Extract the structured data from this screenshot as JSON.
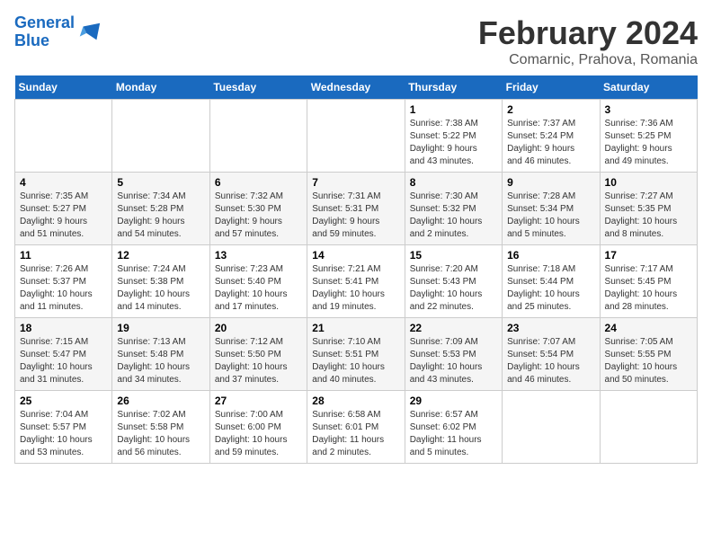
{
  "header": {
    "logo_line1": "General",
    "logo_line2": "Blue",
    "main_title": "February 2024",
    "sub_title": "Comarnic, Prahova, Romania"
  },
  "days_of_week": [
    "Sunday",
    "Monday",
    "Tuesday",
    "Wednesday",
    "Thursday",
    "Friday",
    "Saturday"
  ],
  "weeks": [
    [
      {
        "day": "",
        "info": ""
      },
      {
        "day": "",
        "info": ""
      },
      {
        "day": "",
        "info": ""
      },
      {
        "day": "",
        "info": ""
      },
      {
        "day": "1",
        "info": "Sunrise: 7:38 AM\nSunset: 5:22 PM\nDaylight: 9 hours\nand 43 minutes."
      },
      {
        "day": "2",
        "info": "Sunrise: 7:37 AM\nSunset: 5:24 PM\nDaylight: 9 hours\nand 46 minutes."
      },
      {
        "day": "3",
        "info": "Sunrise: 7:36 AM\nSunset: 5:25 PM\nDaylight: 9 hours\nand 49 minutes."
      }
    ],
    [
      {
        "day": "4",
        "info": "Sunrise: 7:35 AM\nSunset: 5:27 PM\nDaylight: 9 hours\nand 51 minutes."
      },
      {
        "day": "5",
        "info": "Sunrise: 7:34 AM\nSunset: 5:28 PM\nDaylight: 9 hours\nand 54 minutes."
      },
      {
        "day": "6",
        "info": "Sunrise: 7:32 AM\nSunset: 5:30 PM\nDaylight: 9 hours\nand 57 minutes."
      },
      {
        "day": "7",
        "info": "Sunrise: 7:31 AM\nSunset: 5:31 PM\nDaylight: 9 hours\nand 59 minutes."
      },
      {
        "day": "8",
        "info": "Sunrise: 7:30 AM\nSunset: 5:32 PM\nDaylight: 10 hours\nand 2 minutes."
      },
      {
        "day": "9",
        "info": "Sunrise: 7:28 AM\nSunset: 5:34 PM\nDaylight: 10 hours\nand 5 minutes."
      },
      {
        "day": "10",
        "info": "Sunrise: 7:27 AM\nSunset: 5:35 PM\nDaylight: 10 hours\nand 8 minutes."
      }
    ],
    [
      {
        "day": "11",
        "info": "Sunrise: 7:26 AM\nSunset: 5:37 PM\nDaylight: 10 hours\nand 11 minutes."
      },
      {
        "day": "12",
        "info": "Sunrise: 7:24 AM\nSunset: 5:38 PM\nDaylight: 10 hours\nand 14 minutes."
      },
      {
        "day": "13",
        "info": "Sunrise: 7:23 AM\nSunset: 5:40 PM\nDaylight: 10 hours\nand 17 minutes."
      },
      {
        "day": "14",
        "info": "Sunrise: 7:21 AM\nSunset: 5:41 PM\nDaylight: 10 hours\nand 19 minutes."
      },
      {
        "day": "15",
        "info": "Sunrise: 7:20 AM\nSunset: 5:43 PM\nDaylight: 10 hours\nand 22 minutes."
      },
      {
        "day": "16",
        "info": "Sunrise: 7:18 AM\nSunset: 5:44 PM\nDaylight: 10 hours\nand 25 minutes."
      },
      {
        "day": "17",
        "info": "Sunrise: 7:17 AM\nSunset: 5:45 PM\nDaylight: 10 hours\nand 28 minutes."
      }
    ],
    [
      {
        "day": "18",
        "info": "Sunrise: 7:15 AM\nSunset: 5:47 PM\nDaylight: 10 hours\nand 31 minutes."
      },
      {
        "day": "19",
        "info": "Sunrise: 7:13 AM\nSunset: 5:48 PM\nDaylight: 10 hours\nand 34 minutes."
      },
      {
        "day": "20",
        "info": "Sunrise: 7:12 AM\nSunset: 5:50 PM\nDaylight: 10 hours\nand 37 minutes."
      },
      {
        "day": "21",
        "info": "Sunrise: 7:10 AM\nSunset: 5:51 PM\nDaylight: 10 hours\nand 40 minutes."
      },
      {
        "day": "22",
        "info": "Sunrise: 7:09 AM\nSunset: 5:53 PM\nDaylight: 10 hours\nand 43 minutes."
      },
      {
        "day": "23",
        "info": "Sunrise: 7:07 AM\nSunset: 5:54 PM\nDaylight: 10 hours\nand 46 minutes."
      },
      {
        "day": "24",
        "info": "Sunrise: 7:05 AM\nSunset: 5:55 PM\nDaylight: 10 hours\nand 50 minutes."
      }
    ],
    [
      {
        "day": "25",
        "info": "Sunrise: 7:04 AM\nSunset: 5:57 PM\nDaylight: 10 hours\nand 53 minutes."
      },
      {
        "day": "26",
        "info": "Sunrise: 7:02 AM\nSunset: 5:58 PM\nDaylight: 10 hours\nand 56 minutes."
      },
      {
        "day": "27",
        "info": "Sunrise: 7:00 AM\nSunset: 6:00 PM\nDaylight: 10 hours\nand 59 minutes."
      },
      {
        "day": "28",
        "info": "Sunrise: 6:58 AM\nSunset: 6:01 PM\nDaylight: 11 hours\nand 2 minutes."
      },
      {
        "day": "29",
        "info": "Sunrise: 6:57 AM\nSunset: 6:02 PM\nDaylight: 11 hours\nand 5 minutes."
      },
      {
        "day": "",
        "info": ""
      },
      {
        "day": "",
        "info": ""
      }
    ]
  ]
}
